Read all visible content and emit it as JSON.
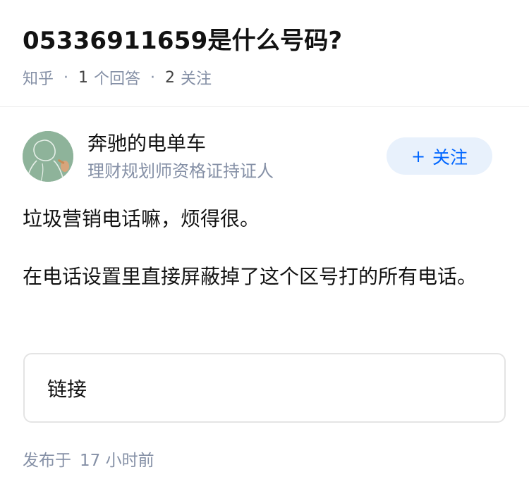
{
  "question": {
    "title": "05336911659是什么号码?",
    "source": "知乎",
    "answers_count": "1",
    "answers_label": "个回答",
    "follows_count": "2",
    "follows_label": "关注"
  },
  "answer": {
    "author": {
      "name": "奔驰的电单车",
      "bio": "理财规划师资格证持证人",
      "avatar_icon": "person-sketch-avatar"
    },
    "follow_button": {
      "plus": "+",
      "label": "关注"
    },
    "paragraphs": [
      "垃圾营销电话嘛，烦得很。",
      "在电话设置里直接屏蔽掉了这个区号打的所有电话。"
    ],
    "link_card_label": "链接",
    "published_prefix": "发布于",
    "published_time": "17 小时前"
  },
  "colors": {
    "accent": "#0066ff",
    "follow_bg": "#e8f1fc",
    "muted_text": "#8590a6",
    "avatar_bg": "#8eb39a"
  }
}
